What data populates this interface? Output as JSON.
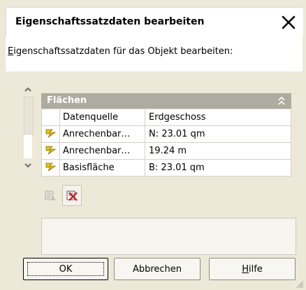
{
  "dialog": {
    "title": "Eigenschaftssatzdaten bearbeiten",
    "instruction_first": "E",
    "instruction_rest": "igenschaftssatzdaten für das Objekt bearbeiten:"
  },
  "group": {
    "title": "Flächen",
    "rows": [
      {
        "icon": "",
        "name": "Datenquelle",
        "value": "Erdgeschoss"
      },
      {
        "icon": "lightning-icon",
        "name": "Anrechenbar…",
        "value": "N: 23.01 qm"
      },
      {
        "icon": "lightning-icon",
        "name": "Anrechenbar…",
        "value": "19.24 m"
      },
      {
        "icon": "lightning-icon",
        "name": "Basisfläche",
        "value": "B: 23.01 qm"
      }
    ]
  },
  "buttons": {
    "ok": "OK",
    "cancel": "Abbrechen",
    "help_first": "H",
    "help_rest": "ilfe"
  },
  "colors": {
    "group_header": "#aeaba1",
    "icon_yellow": "#e3c21b",
    "delete_red": "#c0272d"
  }
}
